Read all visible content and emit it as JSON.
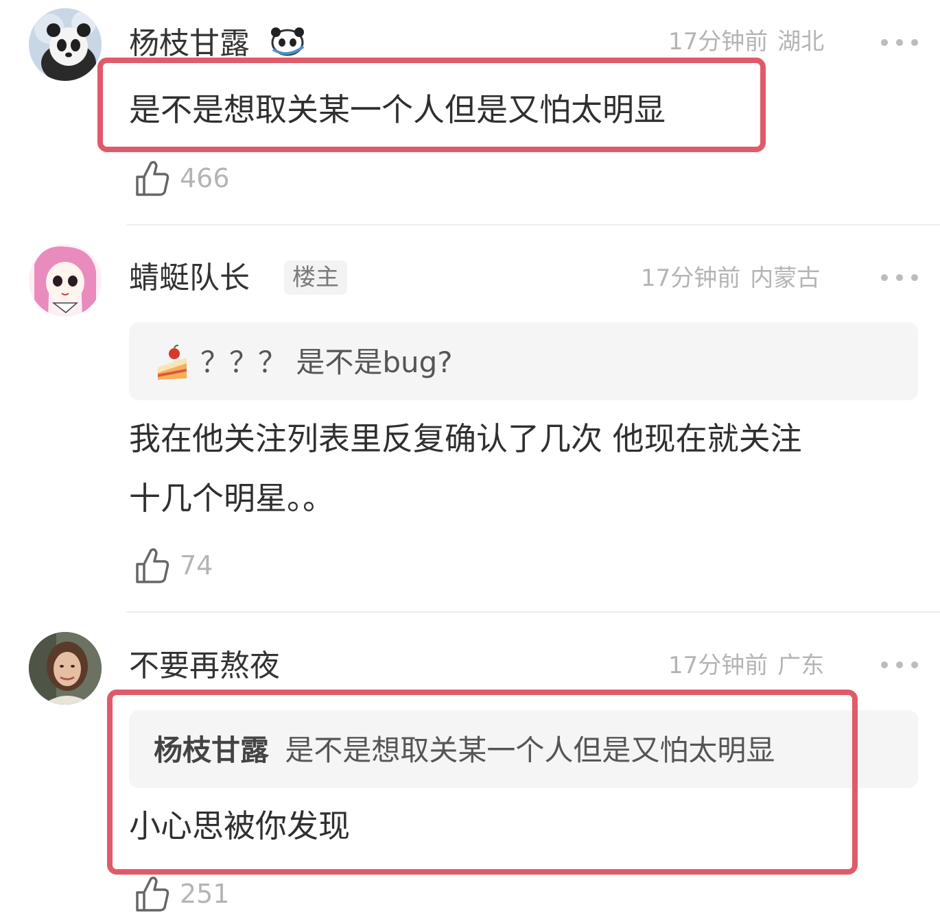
{
  "comments": [
    {
      "username": "杨枝甘露",
      "time": "17分钟前",
      "location": "湖北",
      "text": "是不是想取关某一个人但是又怕太明显",
      "likes": "466"
    },
    {
      "username": "蜻蜓队长",
      "badge": "楼主",
      "time": "17分钟前",
      "location": "内蒙古",
      "quote_text": "？？？ 是不是bug?",
      "text_line1": "我在他关注列表里反复确认了几次 他现在就关注",
      "text_line2": "十几个明星。。",
      "likes": "74"
    },
    {
      "username": "不要再熬夜",
      "time": "17分钟前",
      "location": "广东",
      "reply_to_user": "杨枝甘露",
      "reply_to_text": "是不是想取关某一个人但是又怕太明显",
      "text": "小心思被你发现",
      "likes": "251"
    }
  ],
  "icons": {
    "like": "thumbs-up-icon",
    "more": "more-dots-icon",
    "cake": "cake-emoji-icon",
    "panda": "panda-emoji-icon"
  },
  "colors": {
    "highlight": "#e05a6a",
    "secondary_text": "#b4b4b4",
    "primary_text": "#2f2f2f"
  }
}
